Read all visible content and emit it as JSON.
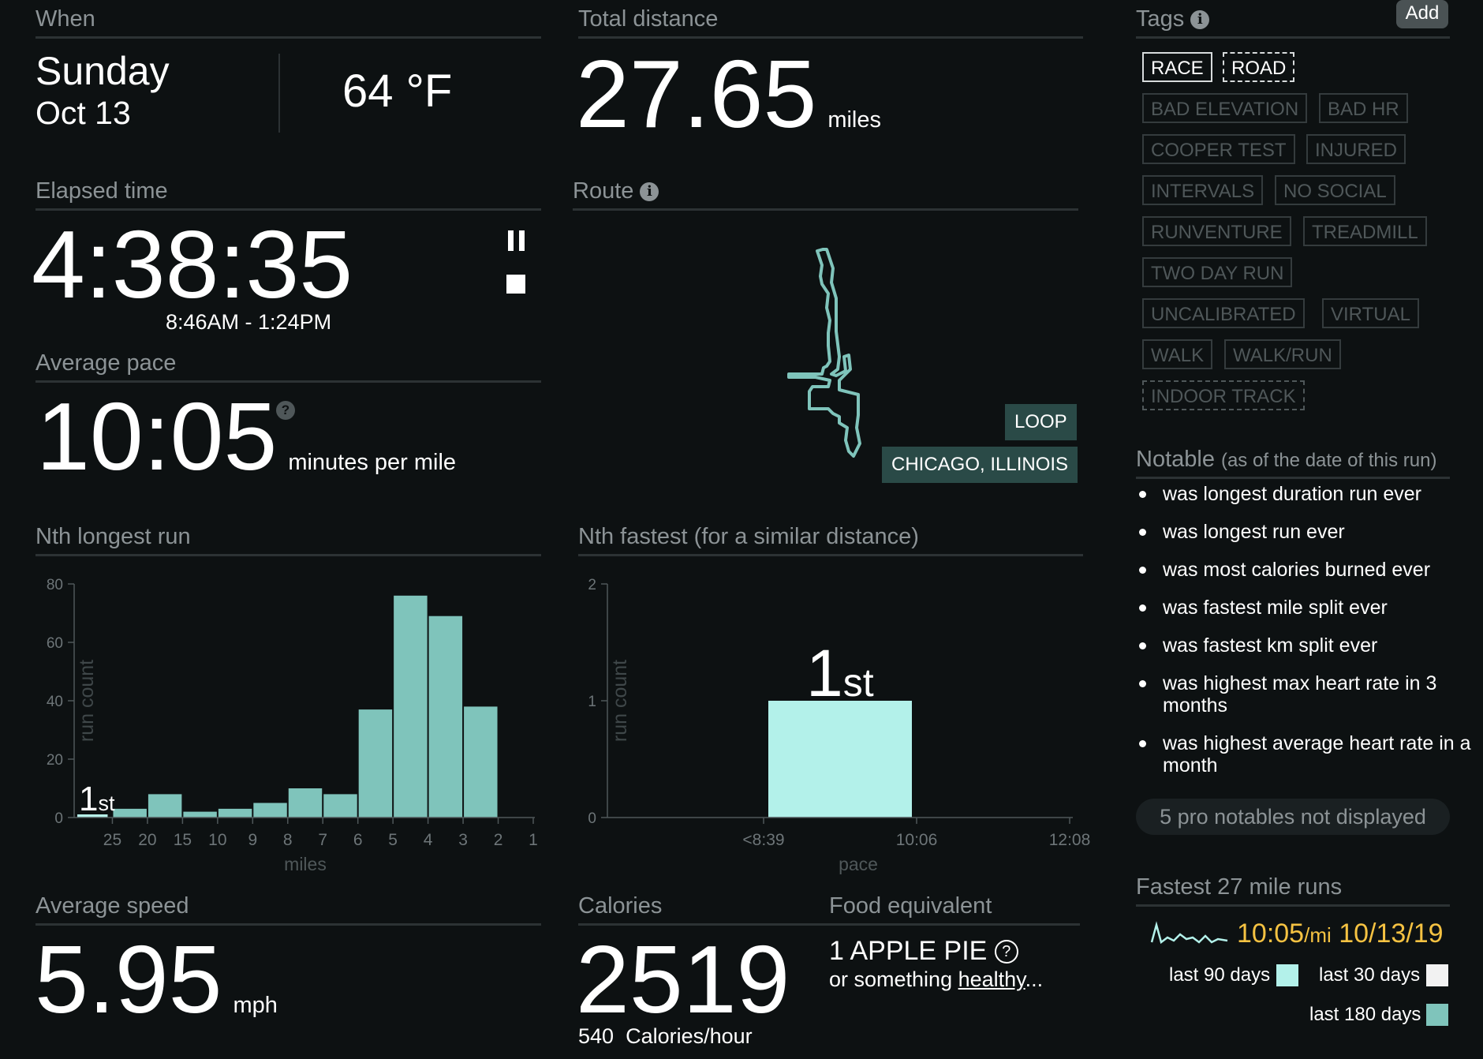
{
  "when": {
    "title": "When",
    "day": "Sunday",
    "date": "Oct 13",
    "temperature": "64 °F"
  },
  "total_distance": {
    "title": "Total distance",
    "value": "27.65",
    "unit": "miles"
  },
  "elapsed": {
    "title": "Elapsed time",
    "value": "4:38:35",
    "range": "8:46AM - 1:24PM"
  },
  "route": {
    "title": "Route",
    "info_icon": "i",
    "loop_label": "LOOP",
    "place_label": "CHICAGO, ILLINOIS"
  },
  "avg_pace": {
    "title": "Average pace",
    "value": "10:05",
    "unit": "minutes per mile",
    "help_icon": "?"
  },
  "tags": {
    "title": "Tags",
    "info_icon": "i",
    "add_label": "Add",
    "items": [
      {
        "label": "RACE",
        "state": "active"
      },
      {
        "label": "ROAD",
        "state": "active-dashed"
      },
      {
        "label": "BAD ELEVATION",
        "state": "inactive"
      },
      {
        "label": "BAD HR",
        "state": "inactive"
      },
      {
        "label": "COOPER TEST",
        "state": "inactive"
      },
      {
        "label": "INJURED",
        "state": "inactive"
      },
      {
        "label": "INTERVALS",
        "state": "inactive"
      },
      {
        "label": "NO SOCIAL",
        "state": "inactive"
      },
      {
        "label": "RUNVENTURE",
        "state": "inactive"
      },
      {
        "label": "TREADMILL",
        "state": "inactive"
      },
      {
        "label": "TWO DAY RUN",
        "state": "inactive"
      },
      {
        "label": "UNCALIBRATED",
        "state": "inactive"
      },
      {
        "label": "VIRTUAL",
        "state": "inactive"
      },
      {
        "label": "WALK",
        "state": "inactive"
      },
      {
        "label": "WALK/RUN",
        "state": "inactive"
      },
      {
        "label": "INDOOR TRACK",
        "state": "inactive-dashed"
      }
    ]
  },
  "notable": {
    "title": "Notable",
    "subtitle": "(as of the date of this run)",
    "items": [
      "was longest duration run ever",
      "was longest run ever",
      "was most calories burned ever",
      "was fastest mile split ever",
      "was fastest km split ever",
      "was highest max heart rate in 3 months",
      "was highest average heart rate in a month"
    ],
    "pro_button": "5 pro notables not displayed"
  },
  "nth_longest": {
    "title": "Nth longest run",
    "rank_number": "1",
    "rank_suffix": "st"
  },
  "nth_fastest": {
    "title": "Nth fastest (for a similar distance)",
    "rank_number": "1",
    "rank_suffix": "st"
  },
  "chart_data": [
    {
      "type": "bar",
      "xlabel": "miles",
      "ylabel": "run count",
      "ylim": [
        0,
        80
      ],
      "yticks": [
        0,
        20,
        40,
        60,
        80
      ],
      "categories": [
        "25",
        "20",
        "15",
        "10",
        "9",
        "8",
        "7",
        "6",
        "5",
        "4",
        "3",
        "2",
        "1"
      ],
      "values": [
        0,
        3,
        8,
        2,
        3,
        5,
        10,
        8,
        37,
        76,
        69,
        38,
        0
      ],
      "bar_fill": "#7fc4bb",
      "highlight_color": "#b7f2ea",
      "grid": false
    },
    {
      "type": "bar",
      "xlabel": "pace",
      "ylabel": "run count",
      "ylim": [
        0,
        2
      ],
      "yticks": [
        0,
        1,
        2
      ],
      "categories": [
        "<8:39",
        "10:06",
        "12:08"
      ],
      "bars": [
        {
          "from": "<8:39",
          "to": "10:06",
          "value": 1
        }
      ],
      "bar_fill": "#b3f1ea",
      "grid": false
    }
  ],
  "avg_speed": {
    "title": "Average speed",
    "value": "5.95",
    "unit": "mph"
  },
  "calories": {
    "title": "Calories",
    "value": "2519",
    "per_hour_value": "540",
    "per_hour_unit": "Calories/hour"
  },
  "food": {
    "title": "Food equivalent",
    "value": "1 APPLE PIE",
    "help_icon": "?",
    "alt_prefix": "or something ",
    "alt_link": "healthy",
    "alt_suffix": "..."
  },
  "fastest_runs": {
    "title": "Fastest 27 mile runs",
    "pace": "10:05",
    "pace_unit": "/mi",
    "date": "10/13/19",
    "highlight_color": "#f5c242",
    "legend": [
      {
        "label": "last 90 days",
        "color": "#b3f1ea"
      },
      {
        "label": "last 30 days",
        "color": "#f2f2f2"
      },
      {
        "label": "last 180 days",
        "color": "#7fc4bb"
      }
    ]
  }
}
